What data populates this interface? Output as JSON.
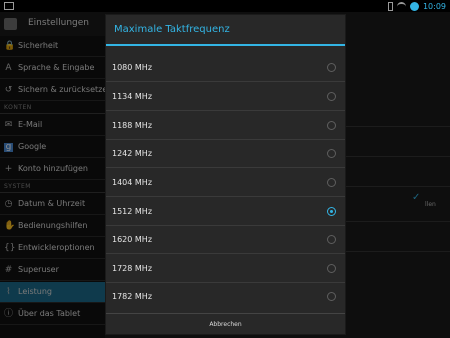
{
  "status_bar": {
    "time": "10:09"
  },
  "header": {
    "title": "Einstellungen"
  },
  "sidebar": {
    "items_top": [
      {
        "label": "Sicherheit",
        "icon": "lock-icon"
      },
      {
        "label": "Sprache & Eingabe",
        "icon": "keyboard-a-icon"
      },
      {
        "label": "Sichern & zurücksetzen",
        "icon": "restore-icon"
      }
    ],
    "section_accounts": "KONTEN",
    "items_accounts": [
      {
        "label": "E-Mail",
        "icon": "email-icon"
      },
      {
        "label": "Google",
        "icon": "google-icon"
      },
      {
        "label": "Konto hinzufügen",
        "icon": "plus-icon"
      }
    ],
    "section_system": "SYSTEM",
    "items_system": [
      {
        "label": "Datum & Uhrzeit",
        "icon": "clock-icon"
      },
      {
        "label": "Bedienungshilfen",
        "icon": "hand-icon"
      },
      {
        "label": "Entwickleroptionen",
        "icon": "braces-icon"
      },
      {
        "label": "Superuser",
        "icon": "hash-icon"
      },
      {
        "label": "Leistung",
        "icon": "performance-icon",
        "selected": true
      },
      {
        "label": "Über das Tablet",
        "icon": "info-icon"
      }
    ]
  },
  "background_pane": {
    "partial_text": "llen"
  },
  "dialog": {
    "title": "Maximale Taktfrequenz",
    "options": [
      {
        "label": "1080 MHz",
        "checked": false
      },
      {
        "label": "1134 MHz",
        "checked": false
      },
      {
        "label": "1188 MHz",
        "checked": false
      },
      {
        "label": "1242 MHz",
        "checked": false
      },
      {
        "label": "1404 MHz",
        "checked": false
      },
      {
        "label": "1512 MHz",
        "checked": true
      },
      {
        "label": "1620 MHz",
        "checked": false
      },
      {
        "label": "1728 MHz",
        "checked": false
      },
      {
        "label": "1782 MHz",
        "checked": false
      }
    ],
    "cancel_label": "Abbrechen"
  },
  "colors": {
    "accent": "#33b5e5",
    "selected_row": "#1c6b8a",
    "dialog_bg": "#282828"
  }
}
